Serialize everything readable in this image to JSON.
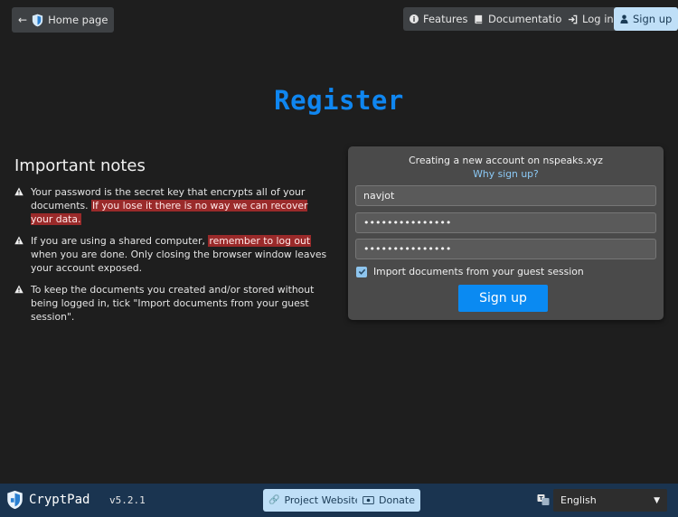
{
  "topbar": {
    "home_label": "Home page",
    "features_label": "Features",
    "docs_label": "Documentation",
    "login_label": "Log in",
    "signup_label": "Sign up"
  },
  "page": {
    "title": "Register"
  },
  "notes": {
    "heading": "Important notes",
    "items": [
      {
        "before": "Your password is the secret key that encrypts all of your documents. ",
        "highlight": "If you lose it there is no way we can recover your data.",
        "after": ""
      },
      {
        "before": "If you are using a shared computer, ",
        "highlight": "remember to log out",
        "after": " when you are done. Only closing the browser window leaves your account exposed."
      },
      {
        "before": "To keep the documents you created and/or stored without being logged in, tick \"Import documents from your guest session\".",
        "highlight": "",
        "after": ""
      }
    ]
  },
  "form": {
    "heading": "Creating a new account on nspeaks.xyz",
    "why_link": "Why sign up?",
    "username_value": "navjot",
    "password_value": "•••••••••••••••",
    "confirm_value": "•••••••••••••••",
    "import_label": "Import documents from your guest session",
    "import_checked": true,
    "submit_label": "Sign up"
  },
  "footer": {
    "brand": "CryptPad",
    "version": "v5.2.1",
    "project_label": "Project Website",
    "donate_label": "Donate",
    "language_selected": "English"
  },
  "colors": {
    "accent": "#0f86f0",
    "footer_bg": "#1a3450",
    "highlight": "#9a2a2a"
  }
}
